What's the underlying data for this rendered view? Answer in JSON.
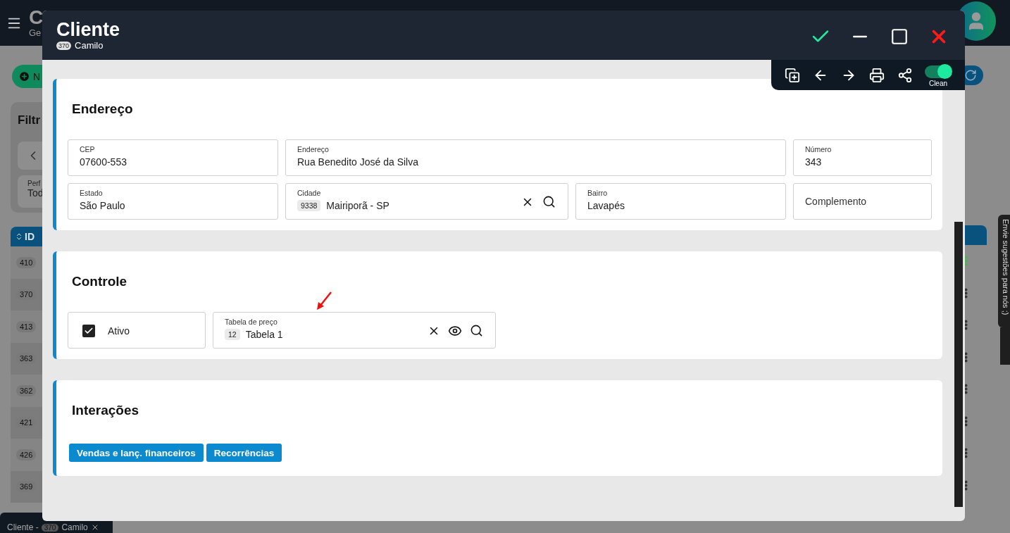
{
  "background": {
    "app_title": "C",
    "app_subtitle": "Ge",
    "new_button": "N",
    "filter_title": "Filtr",
    "filter_label": "Perf",
    "filter_value": "Tod",
    "feedback_tab": "Envie sugestões para nós ;)",
    "table": {
      "id_header": "ID",
      "rows": [
        {
          "id": "410",
          "color": "#4caf50"
        },
        {
          "id": "370",
          "color": "#333333"
        },
        {
          "id": "413",
          "color": "#333333"
        },
        {
          "id": "363",
          "color": "#333333"
        },
        {
          "id": "362",
          "color": "#333333"
        },
        {
          "id": "421",
          "color": "#333333"
        },
        {
          "id": "426",
          "color": "#333333"
        },
        {
          "id": "369",
          "color": "#333333"
        }
      ]
    }
  },
  "taskbar": [
    {
      "label": "Cliente -",
      "badge": "370",
      "name": "Camilo"
    }
  ],
  "modal": {
    "title": "Cliente",
    "badge": "370",
    "subtitle": "Camilo",
    "clean_toggle": {
      "label": "Clean",
      "on": true
    },
    "sections": [
      {
        "kind": "fields",
        "title": "Endereço",
        "fields": [
          {
            "kind": "text",
            "label": "CEP",
            "value": "07600-553"
          },
          {
            "kind": "text",
            "label": "Endereço",
            "value": "Rua Benedito José da Silva"
          },
          {
            "kind": "text",
            "label": "Número",
            "value": "343"
          },
          {
            "kind": "text",
            "label": "Estado",
            "value": "São Paulo"
          },
          {
            "kind": "lookup",
            "label": "Cidade",
            "badge": "9338",
            "value": "Mairiporã - SP",
            "viewable": false
          },
          {
            "kind": "text",
            "label": "Bairro",
            "value": "Lavapés"
          },
          {
            "kind": "empty",
            "placeholder": "Complemento"
          }
        ]
      },
      {
        "kind": "fields",
        "title": "Controle",
        "fields": [
          {
            "kind": "checkbox",
            "label": "Ativo",
            "checked": true
          },
          {
            "kind": "lookup",
            "label": "Tabela de preço",
            "badge": "12",
            "value": "Tabela 1",
            "viewable": true
          }
        ]
      },
      {
        "kind": "buttons",
        "title": "Interações",
        "buttons": [
          "Vendas e lanç. financeiros",
          "Recorrências"
        ]
      }
    ]
  }
}
